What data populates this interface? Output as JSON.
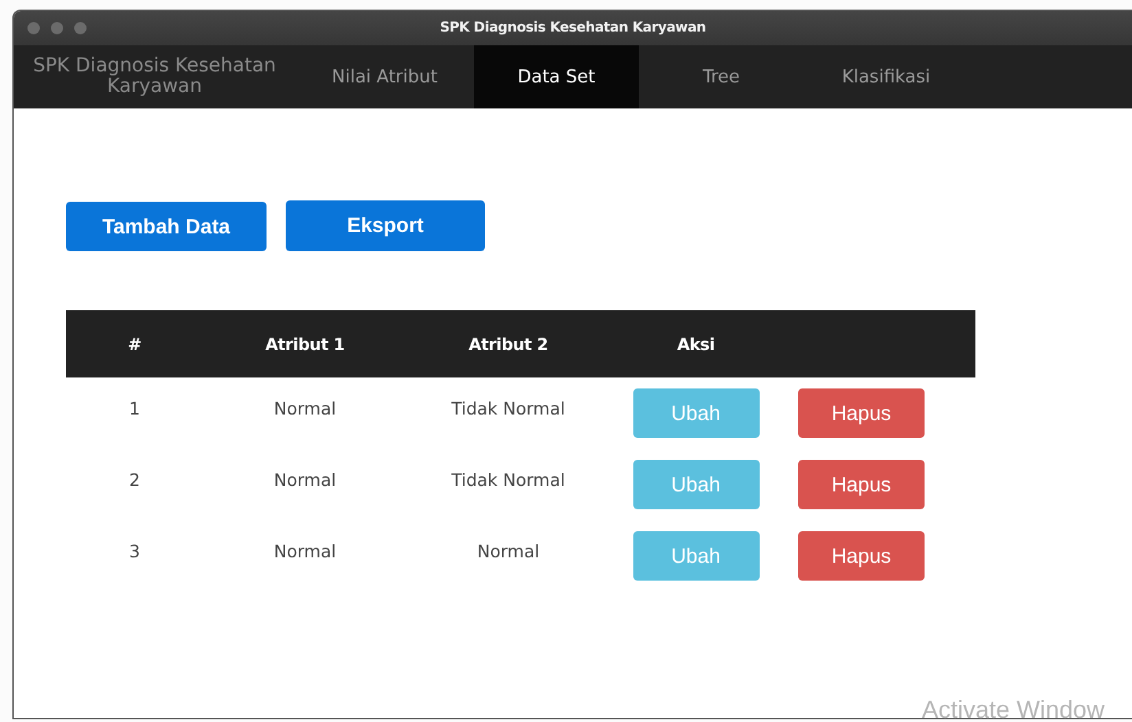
{
  "window": {
    "title": "SPK Diagnosis Kesehatan Karyawan"
  },
  "nav": {
    "brand": "SPK Diagnosis Kesehatan Karyawan",
    "tabs": [
      {
        "label": "Nilai Atribut",
        "selected": false
      },
      {
        "label": "Data Set",
        "selected": true
      },
      {
        "label": "Tree",
        "selected": false
      },
      {
        "label": "Klasifikasi",
        "selected": false
      }
    ]
  },
  "toolbar": {
    "buttons": [
      "Tambah Data",
      "Eksport"
    ]
  },
  "table": {
    "columns": [
      "#",
      "Atribut 1",
      "Atribut 2",
      "Aksi"
    ],
    "rows": [
      {
        "cells": [
          "1",
          "Normal",
          "Tidak Normal"
        ],
        "actions": [
          {
            "label": "Ubah",
            "kind": "edit"
          },
          {
            "label": "Hapus",
            "kind": "delete"
          }
        ]
      },
      {
        "cells": [
          "2",
          "Normal",
          "Tidak Normal"
        ],
        "actions": [
          {
            "label": "Ubah",
            "kind": "edit"
          },
          {
            "label": "Hapus",
            "kind": "delete"
          }
        ]
      },
      {
        "cells": [
          "3",
          "Normal",
          "Normal"
        ],
        "actions": [
          {
            "label": "Ubah",
            "kind": "edit"
          },
          {
            "label": "Hapus",
            "kind": "delete"
          }
        ]
      }
    ]
  },
  "os_notice": "Activate Window"
}
